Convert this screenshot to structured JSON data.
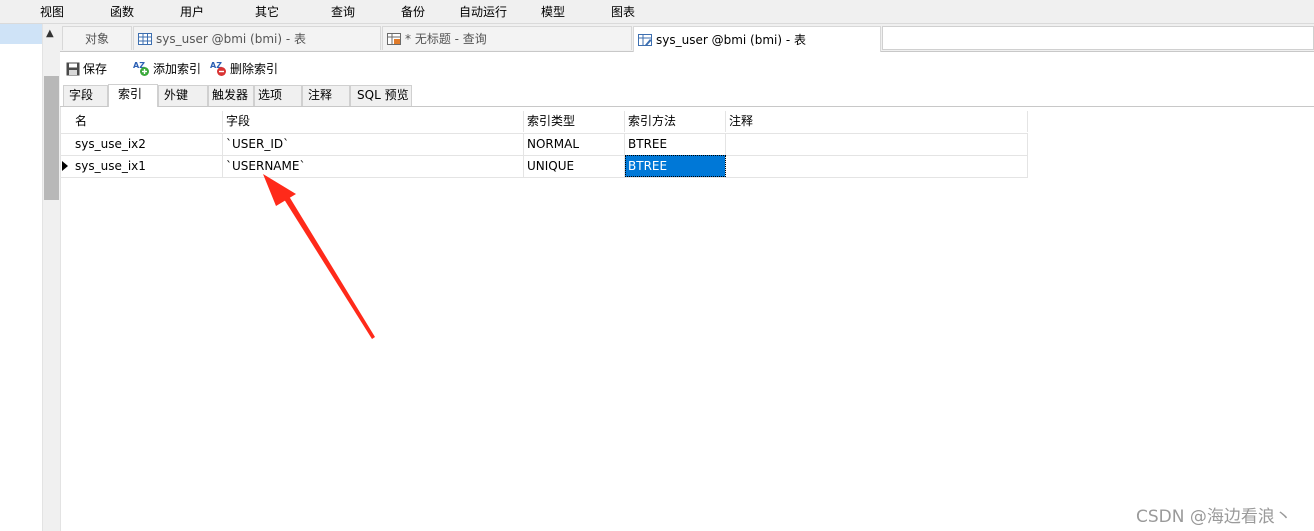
{
  "menu": [
    "视图",
    "函数",
    "用户",
    "其它",
    "查询",
    "备份",
    "自动运行",
    "模型",
    "图表"
  ],
  "tabs": [
    {
      "label": "对象",
      "icon": "none"
    },
    {
      "label": "sys_user @bmi (bmi) - 表",
      "icon": "table-icon"
    },
    {
      "label": "* 无标题 - 查询",
      "icon": "query-icon"
    },
    {
      "label": "sys_user @bmi (bmi) - 表",
      "icon": "table-design-icon"
    }
  ],
  "toolbar": {
    "save_label": "保存",
    "add_index_label": "添加索引",
    "delete_index_label": "删除索引"
  },
  "subtabs": [
    "字段",
    "索引",
    "外键",
    "触发器",
    "选项",
    "注释",
    "SQL 预览"
  ],
  "active_subtab": "索引",
  "grid": {
    "columns": [
      "名",
      "字段",
      "索引类型",
      "索引方法",
      "注释"
    ],
    "rows": [
      {
        "name": "sys_use_ix2",
        "field": "`USER_ID`",
        "type": "NORMAL",
        "method": "BTREE",
        "comment": ""
      },
      {
        "name": "sys_use_ix1",
        "field": "`USERNAME`",
        "type": "UNIQUE",
        "method": "BTREE",
        "comment": ""
      }
    ]
  },
  "watermark": "CSDN @海边看浪丶",
  "colors": {
    "accent": "#0078d7",
    "annotation_arrow": "#ff2a1a"
  }
}
